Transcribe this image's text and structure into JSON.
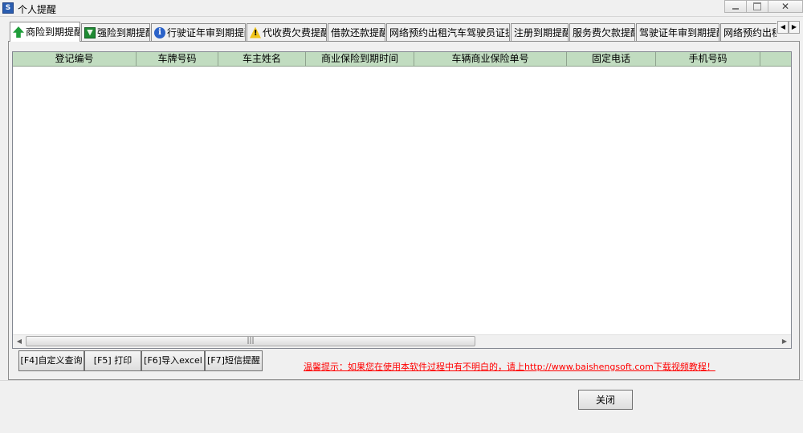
{
  "window": {
    "title": "个人提醒",
    "app_icon_glyph": "S",
    "minimize_icon": "minimize-icon",
    "maximize_icon": "maximize-icon",
    "close_glyph": "✕"
  },
  "tabs": [
    {
      "label": "商险到期提醒",
      "icon": "upload-arrow-icon",
      "active": true
    },
    {
      "label": "强险到期提醒",
      "icon": "download-arrow-icon",
      "active": false
    },
    {
      "label": "行驶证年审到期提醒",
      "icon": "info-icon",
      "active": false
    },
    {
      "label": "代收费欠费提醒",
      "icon": "warning-icon",
      "active": false
    },
    {
      "label": "借款还款提醒",
      "active": false
    },
    {
      "label": "网络预约出租汽车驾驶员证提醒",
      "active": false
    },
    {
      "label": "注册到期提醒",
      "active": false
    },
    {
      "label": "服务费欠款提醒",
      "active": false
    },
    {
      "label": "驾驶证年审到期提醒",
      "active": false
    },
    {
      "label": "网络预约出租汽车",
      "active": false
    }
  ],
  "tab_scroll": {
    "left_glyph": "◀",
    "right_glyph": "▶"
  },
  "grid": {
    "columns": [
      "登记编号",
      "车牌号码",
      "车主姓名",
      "商业保险到期时间",
      "车辆商业保险单号",
      "固定电话",
      "手机号码",
      ""
    ],
    "rows": [],
    "scroll_left_glyph": "◀",
    "scroll_right_glyph": "▶",
    "scroll_thumb_glyph": "|||"
  },
  "actions": {
    "custom_query": "[F4]自定义查询",
    "print": "[F5] 打印",
    "export_excel": "[F6]导入excel",
    "sms_remind": "[F7]短信提醒"
  },
  "tip": "温馨提示：如果您在使用本软件过程中有不明白的，请上http://www.baishengsoft.com下载视频教程！",
  "close_label": "关闭",
  "colors": {
    "grid_header": "#c1dcc0",
    "tip_text": "#ff0000"
  }
}
